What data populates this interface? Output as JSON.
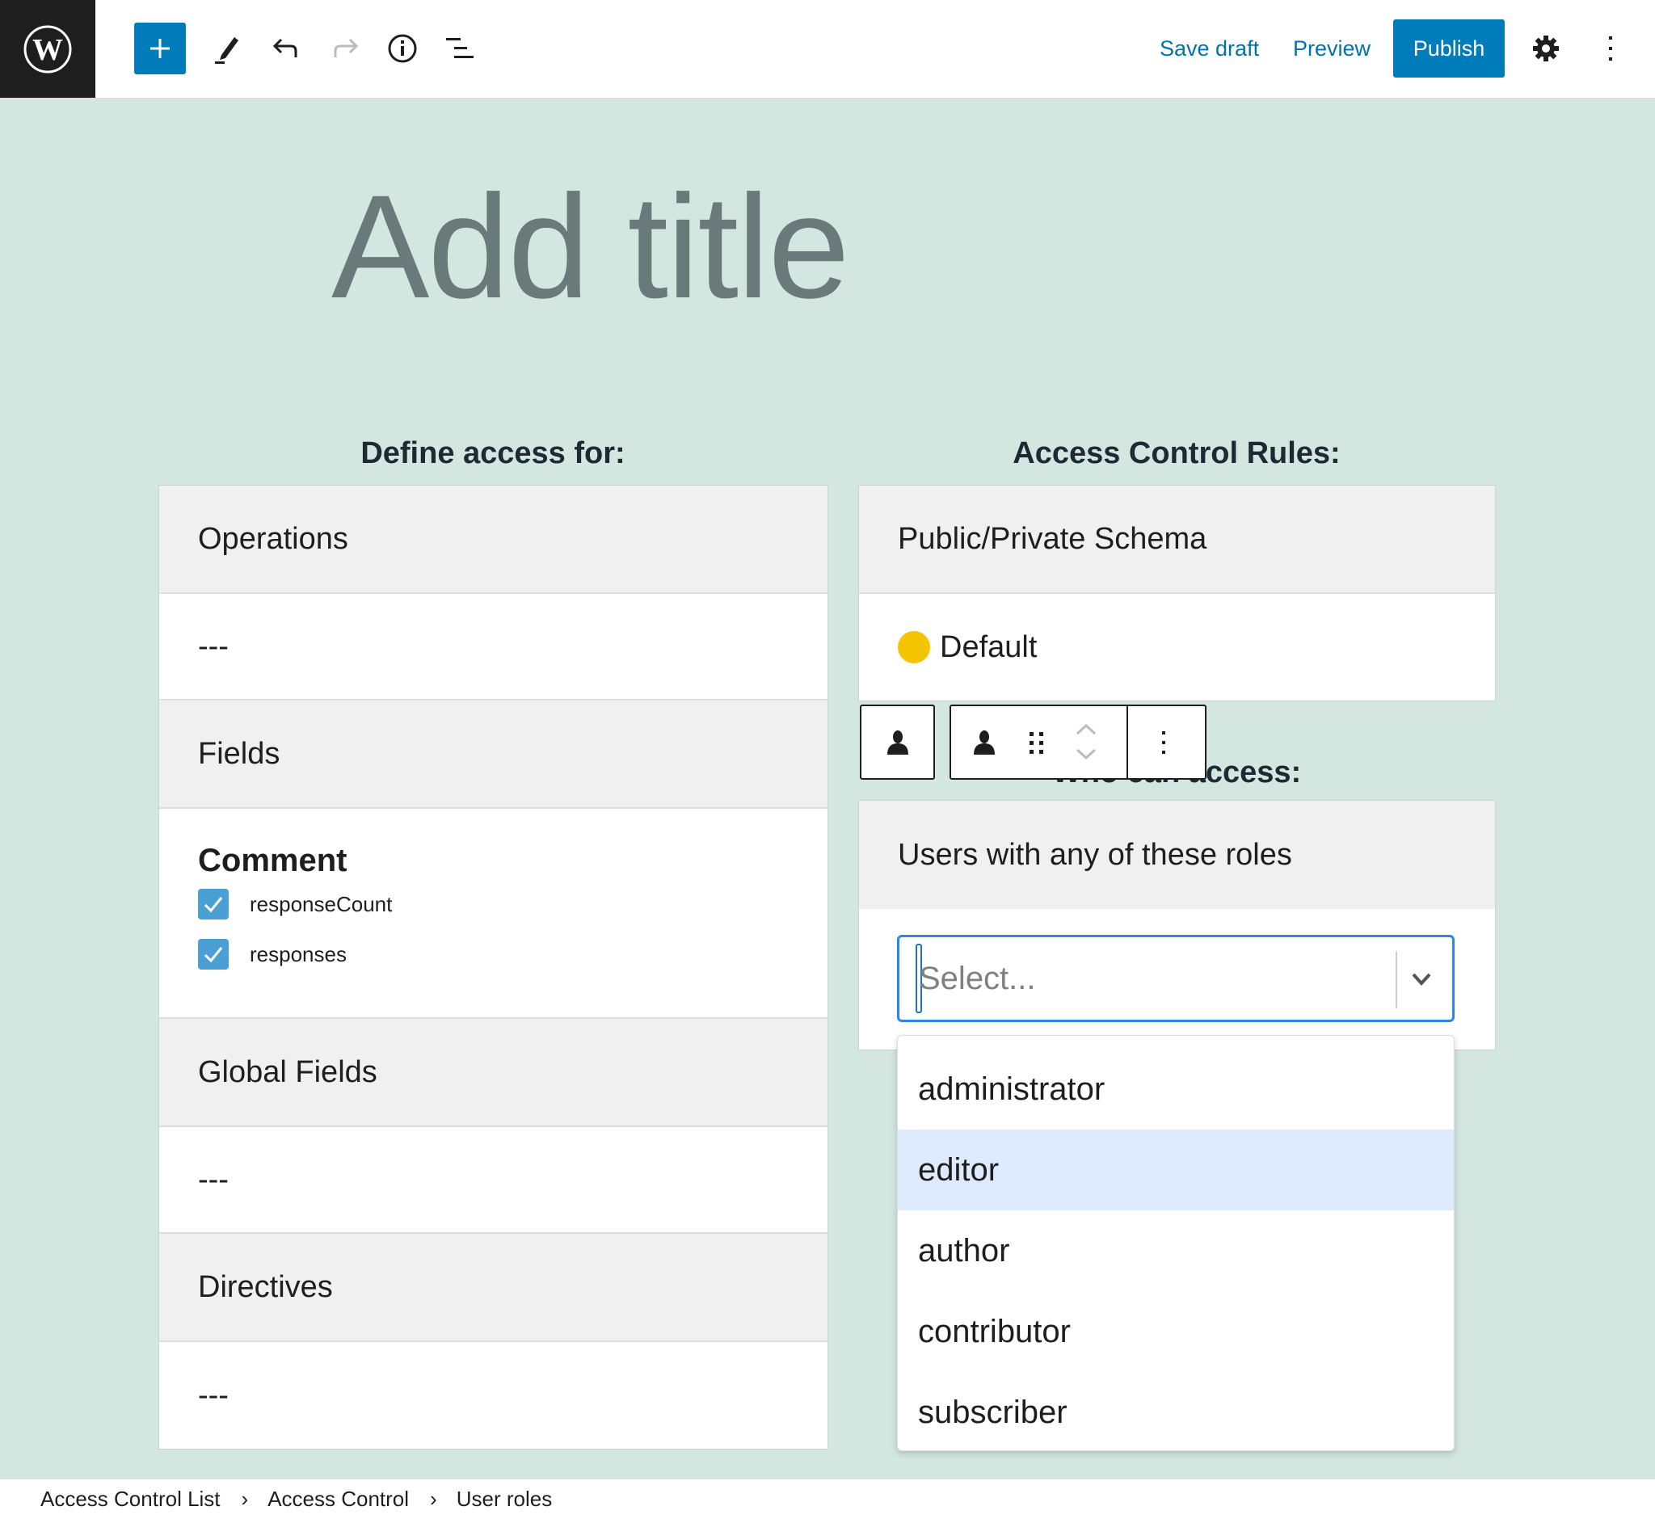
{
  "toolbar": {
    "logo": "wordpress-logo",
    "icons": [
      "plus-icon",
      "pencil-icon",
      "undo-icon",
      "redo-icon",
      "info-icon",
      "list-view-icon"
    ],
    "save_draft": "Save draft",
    "preview": "Preview",
    "publish": "Publish",
    "settings_icon": "gear-icon",
    "more_icon": "more-vertical-icon",
    "accent_color": "#007cba"
  },
  "editor": {
    "title_placeholder": "Add title"
  },
  "left": {
    "heading": "Define access for:",
    "sections": [
      {
        "label": "Operations",
        "value": "---"
      },
      {
        "label": "Fields",
        "group": "Comment",
        "items": [
          {
            "label": "responseCount",
            "checked": true
          },
          {
            "label": "responses",
            "checked": true
          }
        ]
      },
      {
        "label": "Global Fields",
        "value": "---"
      },
      {
        "label": "Directives",
        "value": "---"
      }
    ]
  },
  "right": {
    "heading": "Access Control Rules:",
    "schema_label": "Public/Private Schema",
    "schema_value": "Default",
    "schema_status_color": "#f5c400",
    "who_heading": "Who can access:",
    "roles_label": "Users with any of these roles",
    "select_placeholder": "Select...",
    "options": [
      "administrator",
      "editor",
      "author",
      "contributor",
      "subscriber"
    ],
    "highlighted_option": "editor"
  },
  "block_toolbar": {
    "parent_icon": "user-icon",
    "block_icon": "user-icon",
    "drag_icon": "drag-handle-icon",
    "move_up_icon": "chevron-up-icon",
    "move_down_icon": "chevron-down-icon",
    "options_icon": "more-vertical-icon"
  },
  "breadcrumb": [
    "Access Control List",
    "Access Control",
    "User roles"
  ]
}
